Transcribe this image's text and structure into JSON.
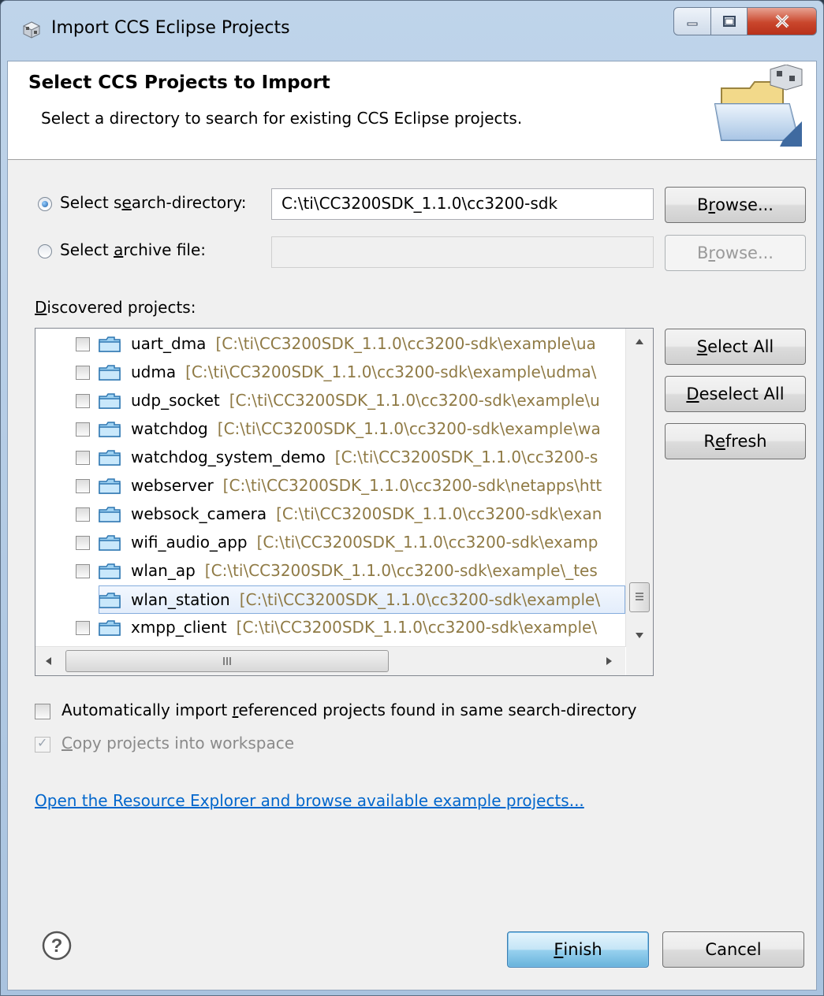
{
  "window": {
    "title": "Import CCS Eclipse Projects",
    "controls": [
      "minimize",
      "maximize",
      "close"
    ]
  },
  "banner": {
    "title": "Select CCS Projects to Import",
    "description": "Select a directory to search for existing CCS Eclipse projects."
  },
  "source": {
    "search_dir": {
      "label_pre": "Select s",
      "label_mn": "e",
      "label_post": "arch-directory:",
      "value": "C:\\ti\\CC3200SDK_1.1.0\\cc3200-sdk",
      "selected": true,
      "browse_pre": "B",
      "browse_mn": "r",
      "browse_post": "owse..."
    },
    "archive": {
      "label_pre": "Select ",
      "label_mn": "a",
      "label_post": "rchive file:",
      "value": "",
      "selected": false,
      "browse_pre": "B",
      "browse_mn": "r",
      "browse_post": "owse..."
    }
  },
  "projects": {
    "label_mn": "D",
    "label_post": "iscovered projects:",
    "items": [
      {
        "name": "uart_dma",
        "path": "[C:\\ti\\CC3200SDK_1.1.0\\cc3200-sdk\\example\\ua",
        "checked": false,
        "selected": false
      },
      {
        "name": "udma",
        "path": "[C:\\ti\\CC3200SDK_1.1.0\\cc3200-sdk\\example\\udma\\",
        "checked": false,
        "selected": false
      },
      {
        "name": "udp_socket",
        "path": "[C:\\ti\\CC3200SDK_1.1.0\\cc3200-sdk\\example\\u",
        "checked": false,
        "selected": false
      },
      {
        "name": "watchdog",
        "path": "[C:\\ti\\CC3200SDK_1.1.0\\cc3200-sdk\\example\\wa",
        "checked": false,
        "selected": false
      },
      {
        "name": "watchdog_system_demo",
        "path": "[C:\\ti\\CC3200SDK_1.1.0\\cc3200-s",
        "checked": false,
        "selected": false
      },
      {
        "name": "webserver",
        "path": "[C:\\ti\\CC3200SDK_1.1.0\\cc3200-sdk\\netapps\\htt",
        "checked": false,
        "selected": false
      },
      {
        "name": "websock_camera",
        "path": "[C:\\ti\\CC3200SDK_1.1.0\\cc3200-sdk\\exan",
        "checked": false,
        "selected": false
      },
      {
        "name": "wifi_audio_app",
        "path": "[C:\\ti\\CC3200SDK_1.1.0\\cc3200-sdk\\examp",
        "checked": false,
        "selected": false
      },
      {
        "name": "wlan_ap",
        "path": "[C:\\ti\\CC3200SDK_1.1.0\\cc3200-sdk\\example\\_tes",
        "checked": false,
        "selected": false
      },
      {
        "name": "wlan_station",
        "path": "[C:\\ti\\CC3200SDK_1.1.0\\cc3200-sdk\\example\\",
        "checked": true,
        "selected": true
      },
      {
        "name": "xmpp_client",
        "path": "[C:\\ti\\CC3200SDK_1.1.0\\cc3200-sdk\\example\\",
        "checked": false,
        "selected": false
      }
    ],
    "select_all": {
      "mn": "S",
      "post": "elect All"
    },
    "deselect_all": {
      "mn": "D",
      "post": "eselect All"
    },
    "refresh": {
      "pre": "R",
      "mn": "e",
      "post": "fresh"
    }
  },
  "options": {
    "auto_import": {
      "pre": "Automatically import ",
      "mn": "r",
      "post": "eferenced projects found in same search-directory",
      "checked": false
    },
    "copy": {
      "mn": "C",
      "post": "opy projects into workspace",
      "checked": true,
      "disabled": true
    }
  },
  "link_text": "Open the Resource Explorer and browse available example projects...",
  "footer": {
    "finish": {
      "mn": "F",
      "post": "inish"
    },
    "cancel": "Cancel"
  },
  "colors": {
    "path_text": "#8f7a45",
    "link": "#0066cc",
    "selection_border": "#84acdd"
  }
}
